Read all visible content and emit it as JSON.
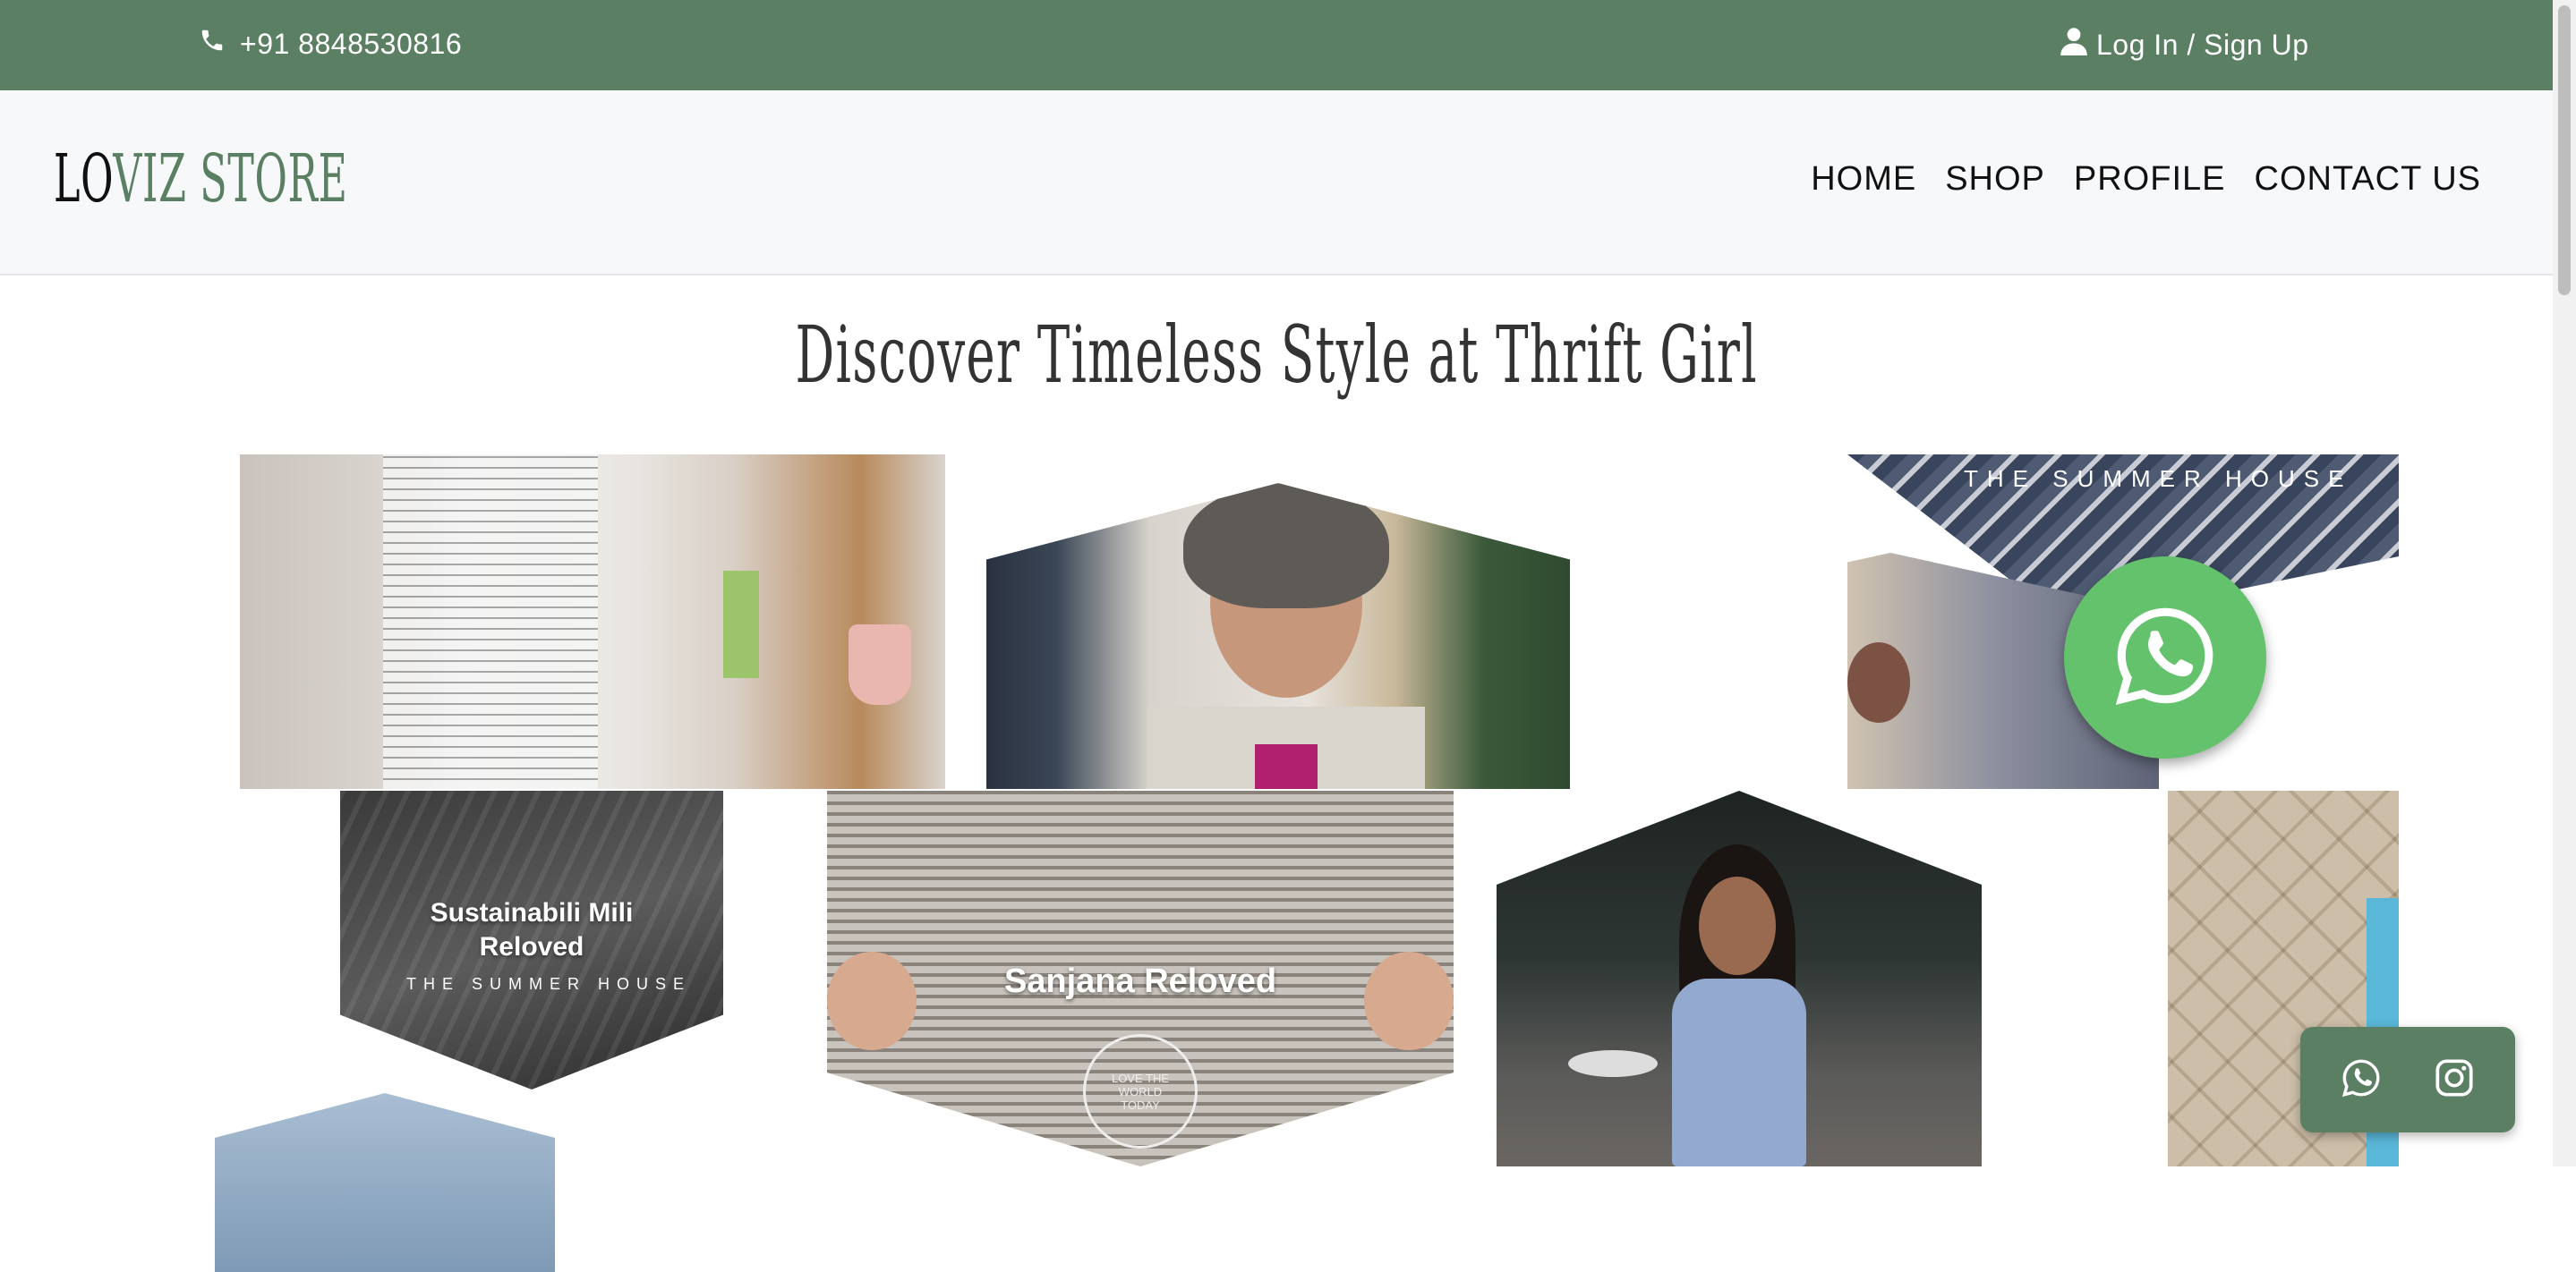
{
  "topbar": {
    "phone_icon": "phone-icon",
    "phone": "+91 8848530816",
    "login_icon": "user-icon",
    "login": "Log In / Sign Up"
  },
  "brand": {
    "part1": "LO",
    "part2": "VIZ STORE"
  },
  "nav": {
    "items": [
      "HOME",
      "SHOP",
      "PROFILE",
      "CONTACT US"
    ]
  },
  "hero": {
    "title": "Discover Timeless Style at Thrift Girl"
  },
  "tiles": {
    "top_right_brand": "THE SUMMER HOUSE",
    "mili_caption": "Sustainabili Mili Reloved",
    "mili_brand": "THE SUMMER HOUSE",
    "sanjana_caption": "Sanjana Reloved",
    "sanjana_badge": "LOVE THE WORLD TODAY"
  },
  "floating": {
    "whatsapp_icon": "whatsapp-icon",
    "social": [
      "whatsapp-icon",
      "instagram-icon"
    ]
  },
  "colors": {
    "accent": "#5b7f63",
    "whatsapp": "#64c26c"
  }
}
